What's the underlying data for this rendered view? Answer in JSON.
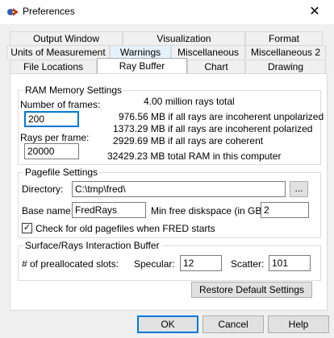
{
  "window": {
    "title": "Preferences"
  },
  "tabs": {
    "row1": [
      "Output Window",
      "Visualization",
      "Format"
    ],
    "row2": [
      "Units of Measurement",
      "Warnings",
      "Miscellaneous",
      "Miscellaneous 2"
    ],
    "row3": [
      "File Locations",
      "Ray Buffer",
      "Chart",
      "Drawing"
    ]
  },
  "ram": {
    "title": "RAM Memory Settings",
    "frames_label": "Number of frames:",
    "frames_value": "200",
    "rays_label": "Rays per frame:",
    "rays_value": "20000",
    "info": [
      "4.00 million rays total",
      "976.56 MB if all rays are incoherent unpolarized",
      "1373.29 MB if all rays are incoherent polarized",
      "2929.69 MB if all rays are coherent",
      "32429.23 MB total RAM in this computer"
    ]
  },
  "pagefile": {
    "title": "Pagefile Settings",
    "directory_label": "Directory:",
    "directory_value": "C:\\tmp\\fred\\",
    "browse_label": "...",
    "basename_label": "Base name:",
    "basename_value": "FredRays",
    "minfree_label": "Min free diskspace (in GB):",
    "minfree_value": "2",
    "check_label": "Check for old pagefiles when FRED starts",
    "check_checked": true
  },
  "surface": {
    "title": "Surface/Rays Interaction Buffer",
    "slots_label": "# of preallocated slots:",
    "specular_label": "Specular:",
    "specular_value": "12",
    "scatter_label": "Scatter:",
    "scatter_value": "101"
  },
  "buttons": {
    "restore": "Restore Default Settings",
    "ok": "OK",
    "cancel": "Cancel",
    "help": "Help"
  }
}
